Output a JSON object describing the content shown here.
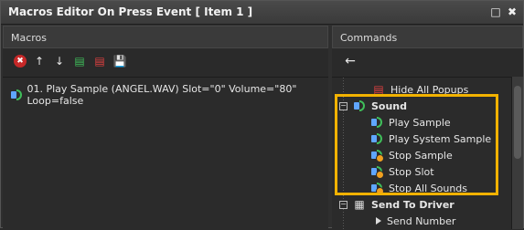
{
  "window": {
    "title": "Macros Editor On Press Event [ Item 1 ]",
    "restore_glyph": "□",
    "close_glyph": "✖"
  },
  "macros": {
    "header": "Macros",
    "toolbar": {
      "delete_glyph": "✖",
      "up_glyph": "↑",
      "down_glyph": "↓",
      "add_glyph": "▤",
      "remove_glyph": "▤",
      "save_glyph": "💾"
    },
    "items": [
      {
        "text": "01. Play Sample (ANGEL.WAV) Slot=\"0\" Volume=\"80\" Loop=false",
        "icon": "speaker-play-icon"
      }
    ]
  },
  "commands": {
    "header": "Commands",
    "back_glyph": "←",
    "items": {
      "hide_all_popups": "Hide All Popups",
      "sound": "Sound",
      "play_sample": "Play Sample",
      "play_system_sample": "Play System Sample",
      "stop_sample": "Stop Sample",
      "stop_slot": "Stop Slot",
      "stop_all_sounds": "Stop All Sounds",
      "send_to_driver": "Send To Driver",
      "send_number": "Send Number"
    }
  },
  "colors": {
    "highlight": "#f2b200",
    "background": "#2b2b2b"
  }
}
